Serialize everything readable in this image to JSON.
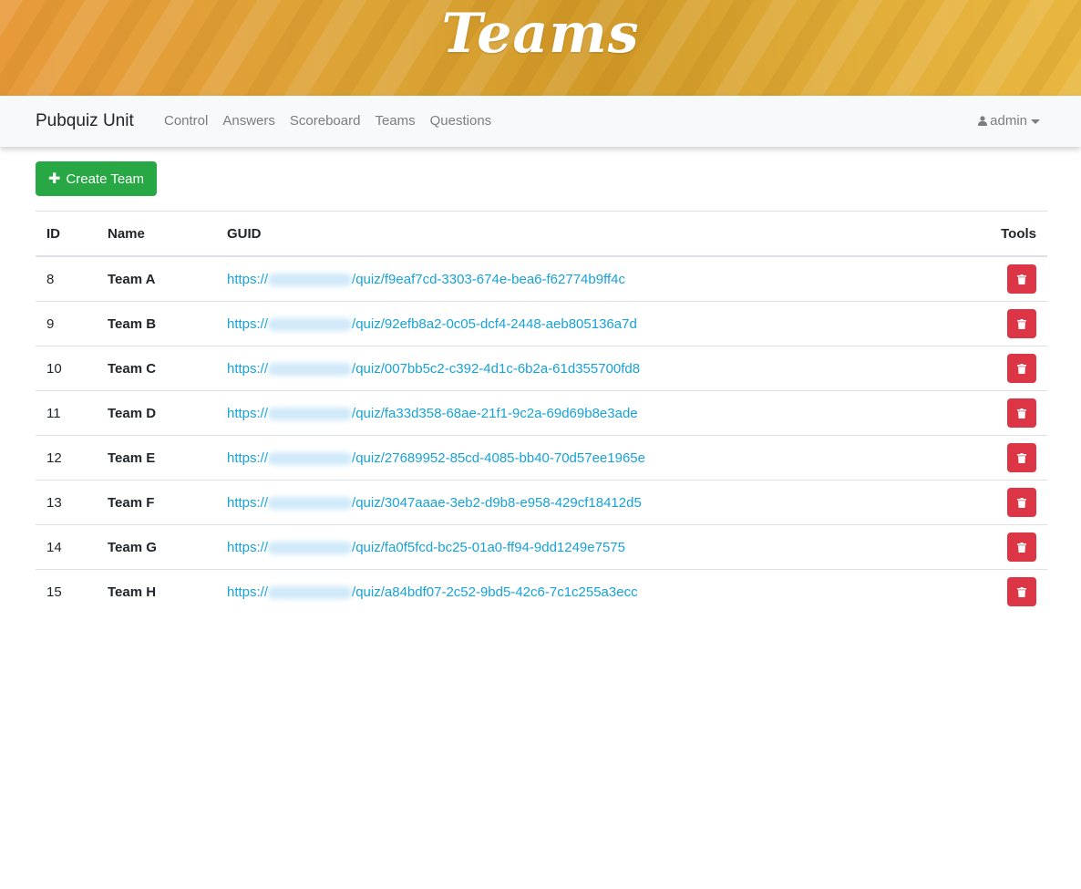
{
  "banner": {
    "title": "Teams"
  },
  "navbar": {
    "brand": "Pubquiz Unit",
    "links": [
      "Control",
      "Answers",
      "Scoreboard",
      "Teams",
      "Questions"
    ],
    "user": "admin"
  },
  "toolbar": {
    "create_label": "Create Team"
  },
  "table": {
    "headers": {
      "id": "ID",
      "name": "Name",
      "guid": "GUID",
      "tools": "Tools"
    },
    "rows": [
      {
        "id": "8",
        "name": "Team A",
        "guid_prefix": "https://",
        "guid_suffix": "/quiz/f9eaf7cd-3303-674e-bea6-f62774b9ff4c"
      },
      {
        "id": "9",
        "name": "Team B",
        "guid_prefix": "https://",
        "guid_suffix": "/quiz/92efb8a2-0c05-dcf4-2448-aeb805136a7d"
      },
      {
        "id": "10",
        "name": "Team C",
        "guid_prefix": "https://",
        "guid_suffix": "/quiz/007bb5c2-c392-4d1c-6b2a-61d355700fd8"
      },
      {
        "id": "11",
        "name": "Team D",
        "guid_prefix": "https://",
        "guid_suffix": "/quiz/fa33d358-68ae-21f1-9c2a-69d69b8e3ade"
      },
      {
        "id": "12",
        "name": "Team E",
        "guid_prefix": "https://",
        "guid_suffix": "/quiz/27689952-85cd-4085-bb40-70d57ee1965e"
      },
      {
        "id": "13",
        "name": "Team F",
        "guid_prefix": "https://",
        "guid_suffix": "/quiz/3047aaae-3eb2-d9b8-e958-429cf18412d5"
      },
      {
        "id": "14",
        "name": "Team G",
        "guid_prefix": "https://",
        "guid_suffix": "/quiz/fa0f5fcd-bc25-01a0-ff94-9dd1249e7575"
      },
      {
        "id": "15",
        "name": "Team H",
        "guid_prefix": "https://",
        "guid_suffix": "/quiz/a84bdf07-2c52-9bd5-42c6-7c1c255a3ecc"
      }
    ]
  },
  "colors": {
    "create_button": "#28a745",
    "delete_button": "#dc3545",
    "link": "#17a2d8"
  },
  "icons": {
    "create": "plus-icon",
    "delete": "trash-icon",
    "user": "user-icon",
    "user_menu_toggle": "chevron-down-icon"
  }
}
